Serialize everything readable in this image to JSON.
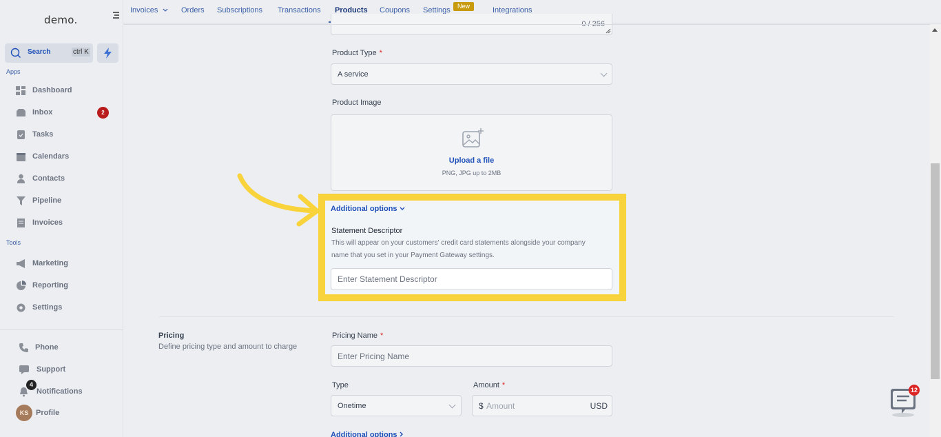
{
  "sidebar": {
    "logo": "demo.",
    "search": {
      "label": "Search",
      "shortcut": "ctrl K"
    },
    "sections": {
      "apps": "Apps",
      "tools": "Tools"
    },
    "apps": [
      {
        "label": "Dashboard",
        "icon": "dashboard-icon"
      },
      {
        "label": "Inbox",
        "icon": "inbox-icon",
        "badge": "2"
      },
      {
        "label": "Tasks",
        "icon": "tasks-icon"
      },
      {
        "label": "Calendars",
        "icon": "calendar-icon"
      },
      {
        "label": "Contacts",
        "icon": "contacts-icon"
      },
      {
        "label": "Pipeline",
        "icon": "pipeline-icon"
      },
      {
        "label": "Invoices",
        "icon": "invoices-icon"
      }
    ],
    "tools": [
      {
        "label": "Marketing",
        "icon": "megaphone-icon"
      },
      {
        "label": "Reporting",
        "icon": "reporting-icon"
      },
      {
        "label": "Settings",
        "icon": "gear-icon"
      }
    ],
    "bottom": {
      "phone": "Phone",
      "support": "Support",
      "notifications": "Notifications",
      "notifications_badge": "4",
      "profile": "Profile",
      "avatar_initials": "KS"
    }
  },
  "topnav": {
    "tabs": [
      "Invoices",
      "Orders",
      "Subscriptions",
      "Transactions",
      "Products",
      "Coupons",
      "Settings",
      "Integrations"
    ],
    "active_tab": "Products",
    "new_badge": "New"
  },
  "form": {
    "char_count": "0 / 256",
    "product_type": {
      "label": "Product Type",
      "required": "*",
      "value": "A service"
    },
    "product_image": {
      "label": "Product Image",
      "upload_link": "Upload a file",
      "hint": "PNG, JPG up to 2MB"
    },
    "additional_options": "Additional options",
    "statement_descriptor": {
      "title": "Statement Descriptor",
      "description": "This will appear on your customers' credit card statements alongside your company name that you set in your Payment Gateway settings.",
      "placeholder": "Enter Statement Descriptor"
    },
    "pricing": {
      "title": "Pricing",
      "subtitle": "Define pricing type and amount to charge",
      "name_label": "Pricing Name",
      "name_placeholder": "Enter Pricing Name",
      "type_label": "Type",
      "type_value": "Onetime",
      "amount_label": "Amount",
      "currency_symbol": "$",
      "amount_placeholder": "Amount",
      "currency": "USD",
      "additional_options": "Additional options"
    }
  },
  "chat": {
    "badge": "12"
  },
  "colors": {
    "highlight": "#f8d33c",
    "accent": "#1e4fb8",
    "badge_red": "#b91c1c"
  }
}
